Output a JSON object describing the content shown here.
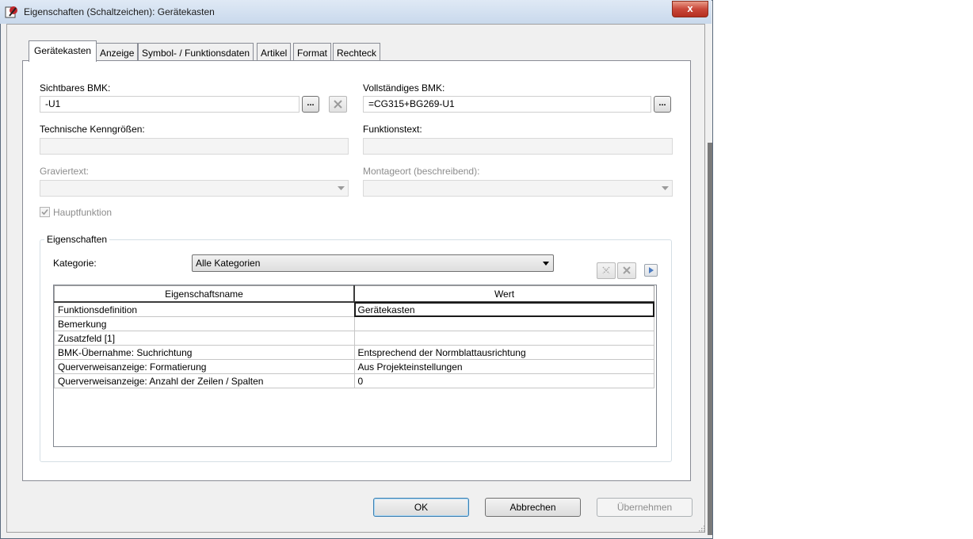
{
  "window": {
    "title": "Eigenschaften (Schaltzeichen): Gerätekasten",
    "close_glyph": "x"
  },
  "tabs": [
    "Gerätekasten",
    "Anzeige",
    "Symbol- / Funktionsdaten",
    "Artikel",
    "Format",
    "Rechteck"
  ],
  "active_tab": "Gerätekasten",
  "fields": {
    "sichtbares_bmk": {
      "label": "Sichtbares BMK:",
      "value": "-U1",
      "browse": "..."
    },
    "vollstaendiges_bmk": {
      "label": "Vollständiges BMK:",
      "value": "=CG315+BG269-U1",
      "browse": "..."
    },
    "technische_kenngroessen": {
      "label": "Technische Kenngrößen:",
      "value": ""
    },
    "funktionstext": {
      "label": "Funktionstext:",
      "value": ""
    },
    "graviertext": {
      "label": "Graviertext:",
      "value": ""
    },
    "montageort": {
      "label": "Montageort (beschreibend):",
      "value": ""
    },
    "hauptfunktion": {
      "label": "Hauptfunktion",
      "checked": true
    }
  },
  "eigenschaften": {
    "group_title": "Eigenschaften",
    "kategorie_label": "Kategorie:",
    "kategorie_value": "Alle Kategorien",
    "columns": [
      "Eigenschaftsname",
      "Wert"
    ],
    "rows": [
      {
        "name": "Funktionsdefinition",
        "value": "Gerätekasten"
      },
      {
        "name": "Bemerkung",
        "value": ""
      },
      {
        "name": "Zusatzfeld [1]",
        "value": ""
      },
      {
        "name": "BMK-Übernahme: Suchrichtung",
        "value": "Entsprechend der Normblattausrichtung"
      },
      {
        "name": "Querverweisanzeige: Formatierung",
        "value": "Aus Projekteinstellungen"
      },
      {
        "name": "Querverweisanzeige: Anzahl der Zeilen / Spalten",
        "value": "0"
      }
    ]
  },
  "buttons": {
    "ok": "OK",
    "cancel": "Abbrechen",
    "apply": "Übernehmen"
  },
  "colors": {
    "accent": "#3c7fb1",
    "disabled_text": "#8d8d8d"
  }
}
